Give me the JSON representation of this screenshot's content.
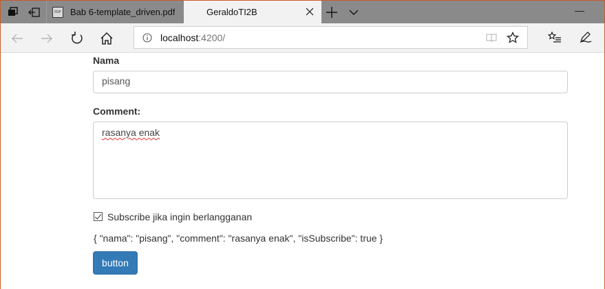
{
  "browser": {
    "tabs": [
      {
        "title": "Bab 6-template_driven.pdf",
        "icon": "pdf-icon",
        "active": false
      },
      {
        "title": "GeraldoTI2B",
        "active": true
      }
    ],
    "pdf_icon_text": "PDF",
    "address": {
      "host": "localhost",
      "port_path": ":4200/"
    }
  },
  "form": {
    "nama_label": "Nama",
    "nama_value": "pisang",
    "comment_label": "Comment:",
    "comment_value": "rasanya enak",
    "subscribe_label": "Subscribe jika ingin berlangganan",
    "subscribe_checked": true,
    "json_output": "{ \"nama\": \"pisang\", \"comment\": \"rasanya enak\", \"isSubscribe\": true }",
    "button_label": "button"
  },
  "colors": {
    "button": "#337ab7",
    "tabstrip": "#8a8a8a",
    "toolbar": "#f2f2f2",
    "window_border": "#c85a28"
  }
}
